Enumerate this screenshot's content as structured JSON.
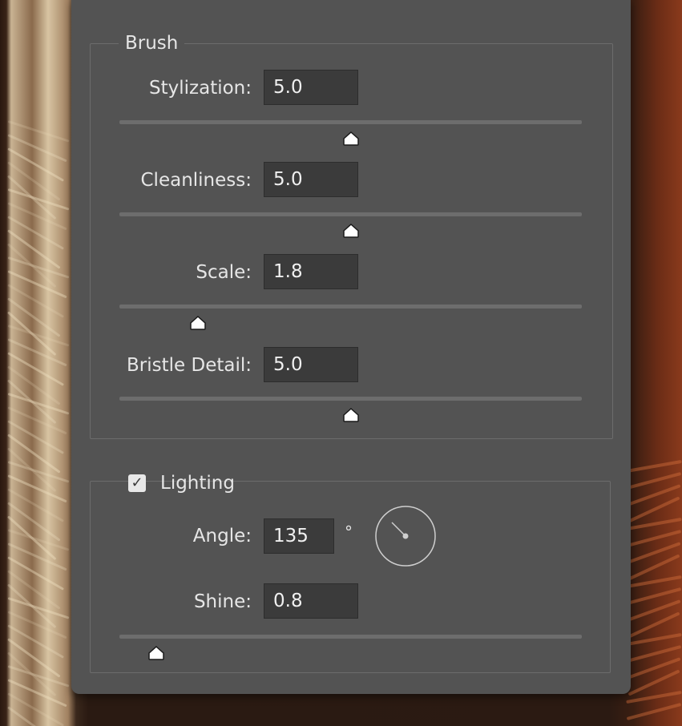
{
  "brush": {
    "title": "Brush",
    "fields": [
      {
        "label": "Stylization:",
        "value": "5.0",
        "level": 0.5
      },
      {
        "label": "Cleanliness:",
        "value": "5.0",
        "level": 0.5
      },
      {
        "label": "Scale:",
        "value": "1.8",
        "level": 0.17
      },
      {
        "label": "Bristle Detail:",
        "value": "5.0",
        "level": 0.5
      }
    ]
  },
  "lighting": {
    "title": "Lighting",
    "enabled": true,
    "angle_label": "Angle:",
    "angle_value": "135",
    "angle_unit": "°",
    "angle_degrees": 135,
    "shine_label": "Shine:",
    "shine_value": "0.8",
    "shine_level": 0.08
  },
  "colors": {
    "panel": "#535353",
    "input": "#3b3b3b",
    "track": "#6d6d6d",
    "text": "#e6e6e6"
  }
}
